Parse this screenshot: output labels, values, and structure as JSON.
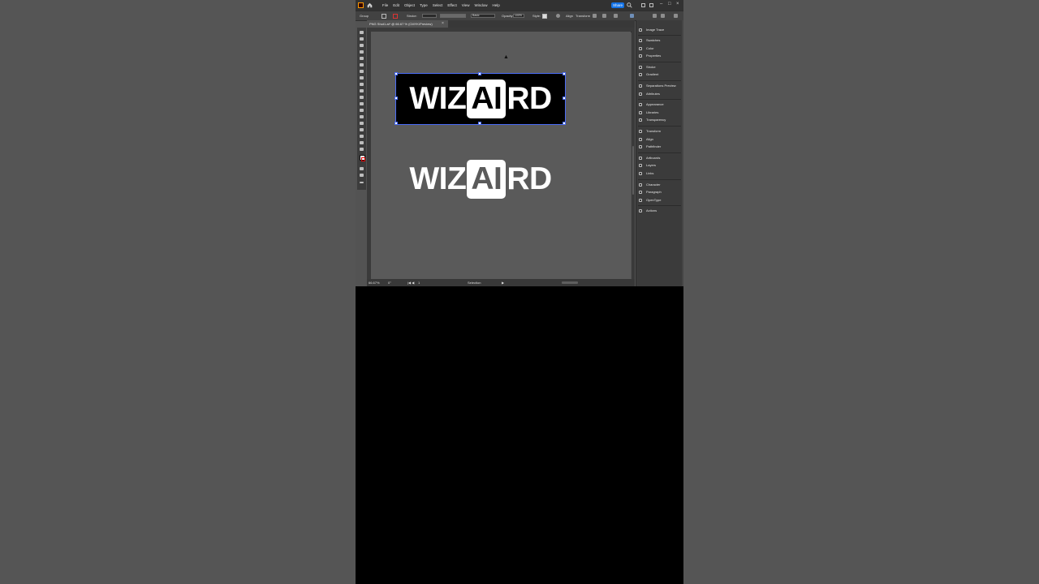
{
  "menubar": {
    "items": [
      "File",
      "Edit",
      "Object",
      "Type",
      "Select",
      "Effect",
      "View",
      "Window",
      "Help"
    ],
    "share_label": "Share"
  },
  "controlbar": {
    "group_label": "Group",
    "stroke_label": "Stroke:",
    "basic_label": "Basic",
    "opacity_label": "Opacity:",
    "opacity_value": "100%",
    "style_label": "Style:",
    "align_label": "Align",
    "transform_label": "Transform"
  },
  "document": {
    "tab_title": "PNG Shot1.ai* @ 66.67 % (CMYK/Preview)",
    "close_glyph": "×"
  },
  "artwork": {
    "word_left": "WIZ",
    "boxed_letters": "AI",
    "word_right": "RD"
  },
  "statusbar": {
    "zoom": "66.67%",
    "rotation": "0°",
    "artboard": "1",
    "tool": "Selection"
  },
  "panels": [
    {
      "label": "Image Trace",
      "icon": "image-trace-icon"
    },
    {
      "label": "Swatches",
      "icon": "swatches-icon"
    },
    {
      "label": "Color",
      "icon": "color-icon"
    },
    {
      "label": "Properties",
      "icon": "properties-icon"
    },
    {
      "label": "Stroke",
      "icon": "stroke-icon"
    },
    {
      "label": "Gradient",
      "icon": "gradient-icon"
    },
    {
      "label": "Separations Preview",
      "icon": "separations-icon"
    },
    {
      "label": "Attributes",
      "icon": "attributes-icon"
    },
    {
      "label": "Appearance",
      "icon": "appearance-icon"
    },
    {
      "label": "Libraries",
      "icon": "libraries-icon"
    },
    {
      "label": "Transparency",
      "icon": "transparency-icon"
    },
    {
      "label": "Transform",
      "icon": "transform-icon"
    },
    {
      "label": "Align",
      "icon": "align-icon"
    },
    {
      "label": "Pathfinder",
      "icon": "pathfinder-icon"
    },
    {
      "label": "Artboards",
      "icon": "artboards-icon"
    },
    {
      "label": "Layers",
      "icon": "layers-icon"
    },
    {
      "label": "Links",
      "icon": "links-icon"
    },
    {
      "label": "Character",
      "icon": "character-icon"
    },
    {
      "label": "Paragraph",
      "icon": "paragraph-icon"
    },
    {
      "label": "OpenType",
      "icon": "opentype-icon"
    },
    {
      "label": "Actions",
      "icon": "actions-icon"
    }
  ],
  "colors": {
    "share_blue": "#1473e6",
    "selection_blue": "#4a6cf7",
    "canvas_gray": "#5a5a5a"
  }
}
